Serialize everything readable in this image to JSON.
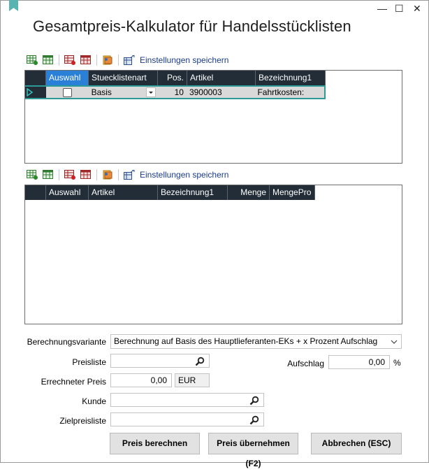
{
  "window": {
    "title": "Gesamtpreis-Kalkulator für Handelsstücklisten",
    "minimize_glyph": "—",
    "maximize_glyph": "☐",
    "close_glyph": "✕"
  },
  "toolbar_top": {
    "save_settings": "Einstellungen speichern"
  },
  "toolbar_bottom": {
    "save_settings": "Einstellungen speichern"
  },
  "grid_top": {
    "columns": [
      "Auswahl",
      "Stuecklistenart",
      "Pos.",
      "Artikel",
      "Bezeichnung1"
    ],
    "rows": [
      {
        "auswahl": false,
        "stuecklistenart": "Basis",
        "pos": "10",
        "artikel": "3900003",
        "bezeichnung1": "Fahrtkosten:"
      }
    ]
  },
  "grid_bottom": {
    "columns": [
      "Auswahl",
      "Artikel",
      "Bezeichnung1",
      "Menge",
      "MengePro"
    ],
    "rows": []
  },
  "form": {
    "berechnungsvariante_label": "Berechnungsvariante",
    "berechnungsvariante_value": "Berechnung auf Basis des Hauptlieferanten-EKs + x Prozent Aufschlag",
    "preisliste_label": "Preisliste",
    "preisliste_value": "",
    "aufschlag_label": "Aufschlag",
    "aufschlag_value": "0,00",
    "aufschlag_unit": "%",
    "errechneter_preis_label": "Errechneter Preis",
    "errechneter_preis_value": "0,00",
    "currency": "EUR",
    "kunde_label": "Kunde",
    "kunde_value": "",
    "zielpreisliste_label": "Zielpreisliste",
    "zielpreisliste_value": ""
  },
  "buttons": {
    "preis_berechnen": "Preis berechnen",
    "preis_uebernehmen": "Preis übernehmen (F2)",
    "abbrechen": "Abbrechen (ESC)"
  },
  "colors": {
    "accent_teal": "#2c9a96",
    "header_dark": "#222d38",
    "header_selected": "#2a7fd6",
    "link_blue": "#1a3b8c"
  }
}
